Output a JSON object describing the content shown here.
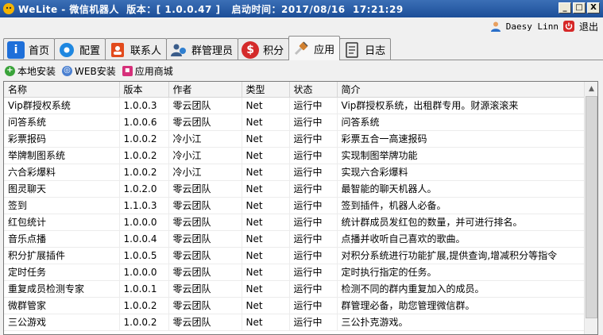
{
  "window": {
    "title": "WeLite - 微信机器人  版本：[ 1.0.0.47 ]   启动时间：2017/08/16  17:21:29",
    "minimize": "_",
    "maximize": "□",
    "close": "X"
  },
  "user": {
    "name": "Daesy Linn",
    "logout": "退出"
  },
  "tabs": [
    {
      "label": "首页",
      "icon": "info-icon",
      "color": "#1e6fd9"
    },
    {
      "label": "配置",
      "icon": "gear-icon",
      "color": "#1e87e0"
    },
    {
      "label": "联系人",
      "icon": "contacts-icon",
      "color": "#e24a1c"
    },
    {
      "label": "群管理员",
      "icon": "group-admin-icon",
      "color": "#3a5c8a"
    },
    {
      "label": "积分",
      "icon": "dollar-icon",
      "color": "#d42a2a"
    },
    {
      "label": "应用",
      "icon": "plugin-icon",
      "color": "#d08030"
    },
    {
      "label": "日志",
      "icon": "log-icon",
      "color": "#333333"
    }
  ],
  "toolbar": {
    "local_install": "本地安装",
    "web_install": "WEB安装",
    "app_store": "应用商城"
  },
  "table": {
    "headers": [
      "名称",
      "版本",
      "作者",
      "类型",
      "状态",
      "简介"
    ],
    "rows": [
      [
        "Vip群授权系统",
        "1.0.0.3",
        "零云团队",
        "Net",
        "运行中",
        "Vip群授权系统，出租群专用。财源滚滚来"
      ],
      [
        "问答系统",
        "1.0.0.6",
        "零云团队",
        "Net",
        "运行中",
        "问答系统"
      ],
      [
        "彩票报码",
        "1.0.0.2",
        "冷小江",
        "Net",
        "运行中",
        "彩票五合一高速报码"
      ],
      [
        "举牌制图系统",
        "1.0.0.2",
        "冷小江",
        "Net",
        "运行中",
        "实现制图举牌功能"
      ],
      [
        "六合彩爆料",
        "1.0.0.2",
        "冷小江",
        "Net",
        "运行中",
        "实现六合彩爆料"
      ],
      [
        "图灵聊天",
        "1.0.2.0",
        "零云团队",
        "Net",
        "运行中",
        "最智能的聊天机器人。"
      ],
      [
        "签到",
        "1.1.0.3",
        "零云团队",
        "Net",
        "运行中",
        "签到插件，机器人必备。"
      ],
      [
        "红包统计",
        "1.0.0.0",
        "零云团队",
        "Net",
        "运行中",
        "统计群成员发红包的数量，并可进行排名。"
      ],
      [
        "音乐点播",
        "1.0.0.4",
        "零云团队",
        "Net",
        "运行中",
        "点播并收听自己喜欢的歌曲。"
      ],
      [
        "积分扩展插件",
        "1.0.0.5",
        "零云团队",
        "Net",
        "运行中",
        "对积分系统进行功能扩展,提供查询,增减积分等指令"
      ],
      [
        "定时任务",
        "1.0.0.0",
        "零云团队",
        "Net",
        "运行中",
        "定时执行指定的任务。"
      ],
      [
        "重复成员检测专家",
        "1.0.0.1",
        "零云团队",
        "Net",
        "运行中",
        "检测不同的群内重复加入的成员。"
      ],
      [
        "微群管家",
        "1.0.0.2",
        "零云团队",
        "Net",
        "运行中",
        "群管理必备，助您管理微信群。"
      ],
      [
        "三公游戏",
        "1.0.0.2",
        "零云团队",
        "Net",
        "运行中",
        "三公扑克游戏。"
      ]
    ]
  }
}
